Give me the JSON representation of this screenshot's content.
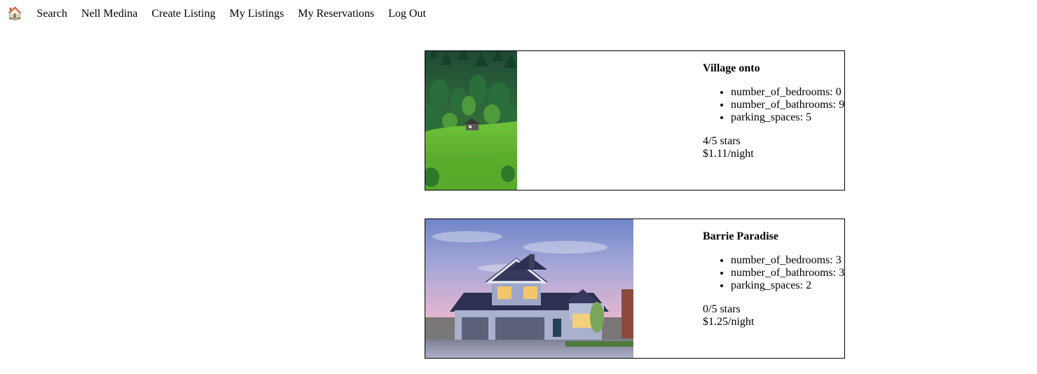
{
  "nav": {
    "home_icon": "🏠",
    "items": [
      "Search",
      "Nell Medina",
      "Create Listing",
      "My Listings",
      "My Reservations",
      "Log Out"
    ]
  },
  "listings": [
    {
      "title": "Village onto",
      "image_icon": "forest-hillside-cabin-photo",
      "features": [
        {
          "key": "number_of_bedrooms",
          "value": "0"
        },
        {
          "key": "number_of_bathrooms",
          "value": "9"
        },
        {
          "key": "parking_spaces",
          "value": "5"
        }
      ],
      "feature_lines": [
        "number_of_bedrooms: 0",
        "number_of_bathrooms: 9",
        "parking_spaces: 5"
      ],
      "rating": "4/5 stars",
      "price": "$1.11/night"
    },
    {
      "title": "Barrie Paradise",
      "image_icon": "suburban-house-dusk-photo",
      "features": [
        {
          "key": "number_of_bedrooms",
          "value": "3"
        },
        {
          "key": "number_of_bathrooms",
          "value": "3"
        },
        {
          "key": "parking_spaces",
          "value": "2"
        }
      ],
      "feature_lines": [
        "number_of_bedrooms: 3",
        "number_of_bathrooms: 3",
        "parking_spaces: 2"
      ],
      "rating": "0/5 stars",
      "price": "$1.25/night"
    }
  ]
}
